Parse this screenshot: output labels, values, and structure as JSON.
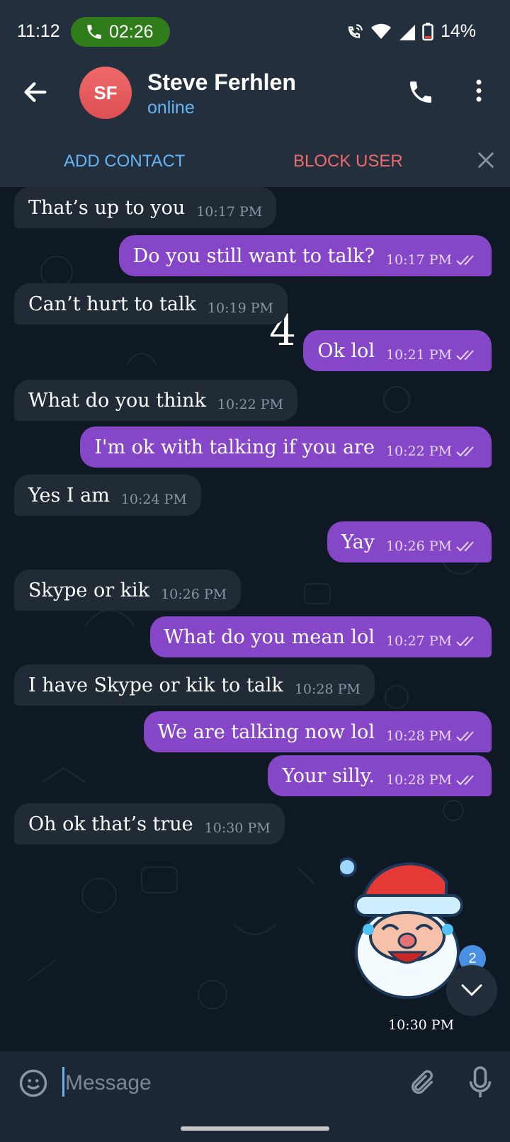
{
  "status_bar": {
    "time": "11:12",
    "call_duration": "02:26",
    "battery": "14%"
  },
  "header": {
    "avatar_initials": "SF",
    "contact_name": "Steve Ferhlen",
    "contact_status": "online",
    "add_contact_label": "ADD CONTACT",
    "block_user_label": "BLOCK USER"
  },
  "chat": {
    "overlay_number": "4",
    "messages": [
      {
        "dir": "in",
        "text": "That’s up to you",
        "time": "10:17 PM"
      },
      {
        "dir": "out",
        "text": "Do you still want to talk?",
        "time": "10:17 PM"
      },
      {
        "dir": "in",
        "text": "Can’t hurt to talk",
        "time": "10:19 PM"
      },
      {
        "dir": "out",
        "text": "Ok lol",
        "time": "10:21 PM"
      },
      {
        "dir": "in",
        "text": "What do you think",
        "time": "10:22 PM"
      },
      {
        "dir": "out",
        "text": "I'm ok with talking if you are",
        "time": "10:22 PM"
      },
      {
        "dir": "in",
        "text": "Yes I am",
        "time": "10:24 PM"
      },
      {
        "dir": "out",
        "text": "Yay",
        "time": "10:26 PM"
      },
      {
        "dir": "in",
        "text": "Skype or kik",
        "time": "10:26 PM"
      },
      {
        "dir": "out",
        "text": "What do you mean lol",
        "time": "10:27 PM"
      },
      {
        "dir": "in",
        "text": "I have Skype or kik to talk",
        "time": "10:28 PM"
      },
      {
        "dir": "out",
        "text": "We are talking now lol",
        "time": "10:28 PM"
      },
      {
        "dir": "out",
        "text": "Your silly.",
        "time": "10:28 PM"
      },
      {
        "dir": "in",
        "text": "Oh ok that’s true",
        "time": "10:30 PM"
      }
    ],
    "sticker": {
      "icon": "santa-laughing-sticker",
      "time": "10:30 PM"
    },
    "unread_count": "2"
  },
  "input": {
    "placeholder": "Message"
  },
  "colors": {
    "outgoing_bubble": "#8547c7",
    "incoming_bubble": "#202b36",
    "accent": "#64b5f6",
    "danger": "#ef6b6b",
    "call_pill": "#2e7d1a"
  }
}
